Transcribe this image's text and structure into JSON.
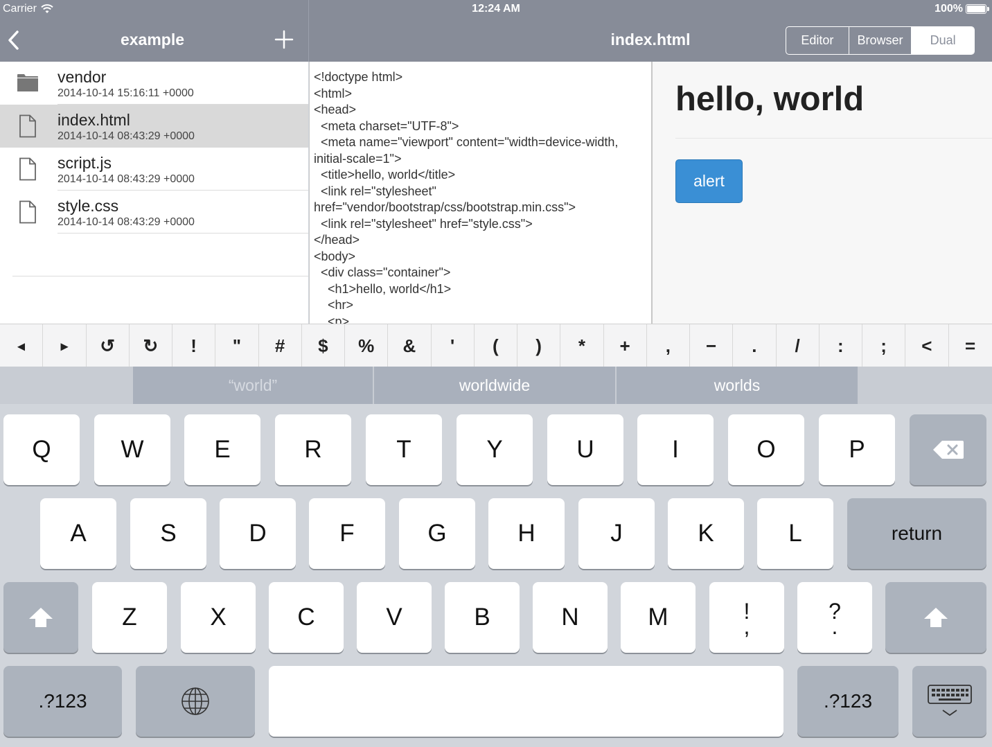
{
  "status": {
    "carrier": "Carrier",
    "time": "12:24 AM",
    "battery": "100%"
  },
  "nav": {
    "left_title": "example",
    "right_title": "index.html",
    "segments": [
      "Editor",
      "Browser",
      "Dual"
    ],
    "active_segment": "Dual"
  },
  "files": [
    {
      "name": "vendor",
      "date": "2014-10-14 15:16:11 +0000",
      "type": "folder",
      "selected": false
    },
    {
      "name": "index.html",
      "date": "2014-10-14 08:43:29 +0000",
      "type": "file",
      "selected": true
    },
    {
      "name": "script.js",
      "date": "2014-10-14 08:43:29 +0000",
      "type": "file",
      "selected": false
    },
    {
      "name": "style.css",
      "date": "2014-10-14 08:43:29 +0000",
      "type": "file",
      "selected": false
    }
  ],
  "editor": {
    "code": "<!doctype html>\n<html>\n<head>\n  <meta charset=\"UTF-8\">\n  <meta name=\"viewport\" content=\"width=device-width, initial-scale=1\">\n  <title>hello, world</title>\n  <link rel=\"stylesheet\" href=\"vendor/bootstrap/css/bootstrap.min.css\">\n  <link rel=\"stylesheet\" href=\"style.css\">\n</head>\n<body>\n  <div class=\"container\">\n    <h1>hello, world</h1>\n    <hr>\n    <p>"
  },
  "preview": {
    "heading": "hello, world",
    "button": "alert"
  },
  "accessory_keys": [
    "◂",
    "▸",
    "↺",
    "↻",
    "!",
    "\"",
    "#",
    "$",
    "%",
    "&",
    "'",
    "(",
    ")",
    "*",
    "+",
    ",",
    "−",
    ".",
    "/",
    ":",
    ";",
    "<",
    "="
  ],
  "suggestions": [
    "“world”",
    "worldwide",
    "worlds"
  ],
  "keyboard": {
    "row1": [
      "Q",
      "W",
      "E",
      "R",
      "T",
      "Y",
      "U",
      "I",
      "O",
      "P"
    ],
    "row2": [
      "A",
      "S",
      "D",
      "F",
      "G",
      "H",
      "J",
      "K",
      "L"
    ],
    "row3": [
      "Z",
      "X",
      "C",
      "V",
      "B",
      "N",
      "M"
    ],
    "exclaim_top": "!",
    "exclaim_bottom": ",",
    "question_top": "?",
    "question_bottom": ".",
    "return": "return",
    "numbers": ".?123"
  },
  "colors": {
    "navbar": "#878c98",
    "accent_button": "#3a8fd5",
    "selected_row": "#d9d9d9"
  }
}
